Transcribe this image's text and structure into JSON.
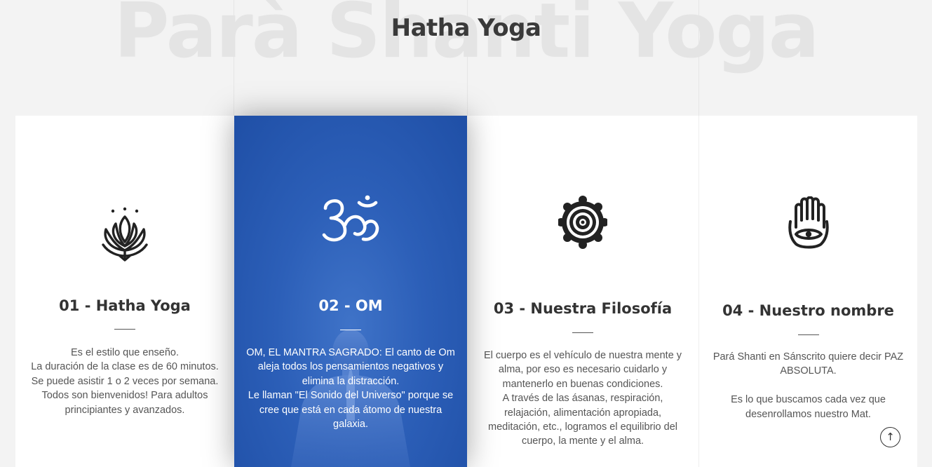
{
  "header": {
    "watermark": "Parà Shanti Yoga",
    "title": "Hatha Yoga"
  },
  "cards": [
    {
      "icon": "lotus-icon",
      "title": "01 - Hatha Yoga",
      "lines": [
        "Es el estilo que enseño.",
        "La duración de la clase es de 60 minutos.",
        "Se puede asistir 1 o 2 veces por semana.",
        "Todos son bienvenidos! Para adultos",
        "principiantes y avanzados."
      ]
    },
    {
      "icon": "om-icon",
      "title": "02 - OM",
      "lines": [
        "OM, EL MANTRA SAGRADO: El canto de Om",
        "aleja todos los pensamientos negativos y",
        "elimina la distracción.",
        "Le llaman \"El Sonido del Universo\" porque se",
        "cree que está en cada átomo de nuestra",
        "galaxia."
      ]
    },
    {
      "icon": "chakra-icon",
      "title": "03 - Nuestra Filosofía",
      "lines": [
        "El cuerpo es el vehículo de nuestra mente y",
        "alma, por eso es necesario cuidarlo y",
        "mantenerlo en buenas condiciones.",
        "A través de las ásanas, respiración,",
        "relajación, alimentación apropiada,",
        "meditación, etc., logramos el equilibrio del",
        "cuerpo, la mente y el alma."
      ]
    },
    {
      "icon": "hamsa-icon",
      "title": "04 - Nuestro nombre",
      "lines": [
        "Pará Shanti en Sánscrito quiere decir PAZ",
        "ABSOLUTA.",
        "",
        "Es lo que buscamos cada vez que",
        "desenrollamos nuestro Mat."
      ]
    }
  ],
  "scroll_top": {
    "glyph": "↑",
    "icon": "arrow-up-icon"
  }
}
